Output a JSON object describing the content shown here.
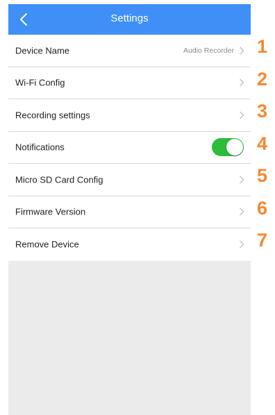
{
  "header": {
    "title": "Settings",
    "background_color": "#3f8ff7",
    "back_icon": "chevron-left-icon"
  },
  "settings": {
    "items": [
      {
        "label": "Device Name",
        "value": "Audio Recorder",
        "control": "chevron-right-icon"
      },
      {
        "label": "Wi-Fi Config",
        "control": "chevron-right-icon"
      },
      {
        "label": "Recording settings",
        "control": "chevron-right-icon"
      },
      {
        "label": "Notifications",
        "control": "toggle",
        "toggle_on": true,
        "toggle_color": "#2dbd3a"
      },
      {
        "label": "Micro SD Card Config",
        "control": "chevron-right-icon"
      },
      {
        "label": "Firmware Version",
        "control": "chevron-right-icon"
      },
      {
        "label": "Remove Device",
        "control": "chevron-right-icon"
      }
    ]
  },
  "callouts": {
    "numbers": [
      "1",
      "2",
      "3",
      "4",
      "5",
      "6",
      "7"
    ],
    "color": "#f7882f"
  }
}
